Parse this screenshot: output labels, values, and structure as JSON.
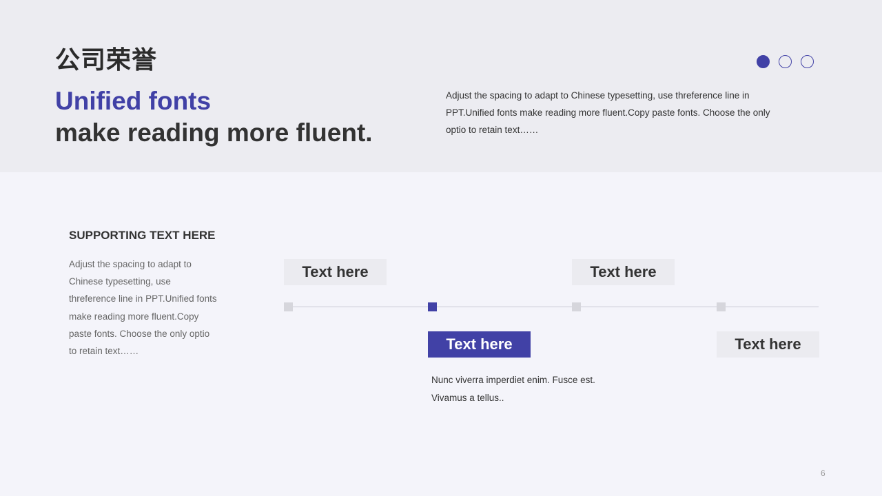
{
  "header": {
    "title_cn": "公司荣誉",
    "headline_line1": "Unified fonts",
    "headline_line2": "make reading more fluent.",
    "description": "Adjust the spacing to adapt to Chinese typesetting, use threference line in PPT.Unified fonts make reading more fluent.Copy paste fonts. Choose the only optio to retain text……",
    "pagination_dots": [
      {
        "state": "filled"
      },
      {
        "state": "outline"
      },
      {
        "state": "outline"
      }
    ]
  },
  "support": {
    "heading": "SUPPORTING TEXT HERE",
    "body": "Adjust the spacing to adapt to Chinese typesetting, use threference line in PPT.Unified fonts make reading more fluent.Copy paste fonts. Choose the only optio to retain text……"
  },
  "timeline": {
    "milestones": [
      {
        "label": "Text here",
        "position": "above",
        "active": false
      },
      {
        "label": "Text here",
        "position": "below",
        "active": true
      },
      {
        "label": "Text here",
        "position": "above",
        "active": false
      },
      {
        "label": "Text here",
        "position": "below",
        "active": false
      }
    ],
    "active_description": "Nunc viverra imperdiet enim. Fusce est. Vivamus a tellus.."
  },
  "colors": {
    "accent": "#4141a6",
    "header_band": "#ececf1",
    "page_background": "#f4f4fa",
    "marker_inactive": "#d6d6dc"
  },
  "footer": {
    "page_number": "6"
  }
}
